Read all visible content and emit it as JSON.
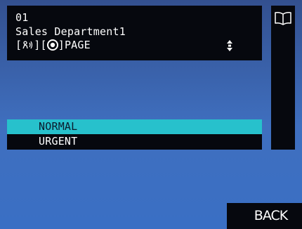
{
  "header": {
    "number": "01",
    "name": "Sales Department1",
    "mode": {
      "open_bracket_1": "[",
      "voice_icon": "voice-call-icon",
      "close_bracket_1": "]",
      "open_bracket_2": "[",
      "target_icon": "target-circle-icon",
      "close_bracket_2": "]",
      "label": "PAGE"
    },
    "scroll_icon": "up-down-scroll-icon"
  },
  "side": {
    "book_icon": "open-book-icon"
  },
  "options": [
    {
      "label": "NORMAL",
      "selected": true
    },
    {
      "label": "URGENT",
      "selected": false
    }
  ],
  "footer": {
    "back_label": "BACK"
  },
  "colors": {
    "panel": "#06080e",
    "selected": "#27c1cc",
    "background_top": "#33508f",
    "background_bottom": "#3a6fc4"
  }
}
